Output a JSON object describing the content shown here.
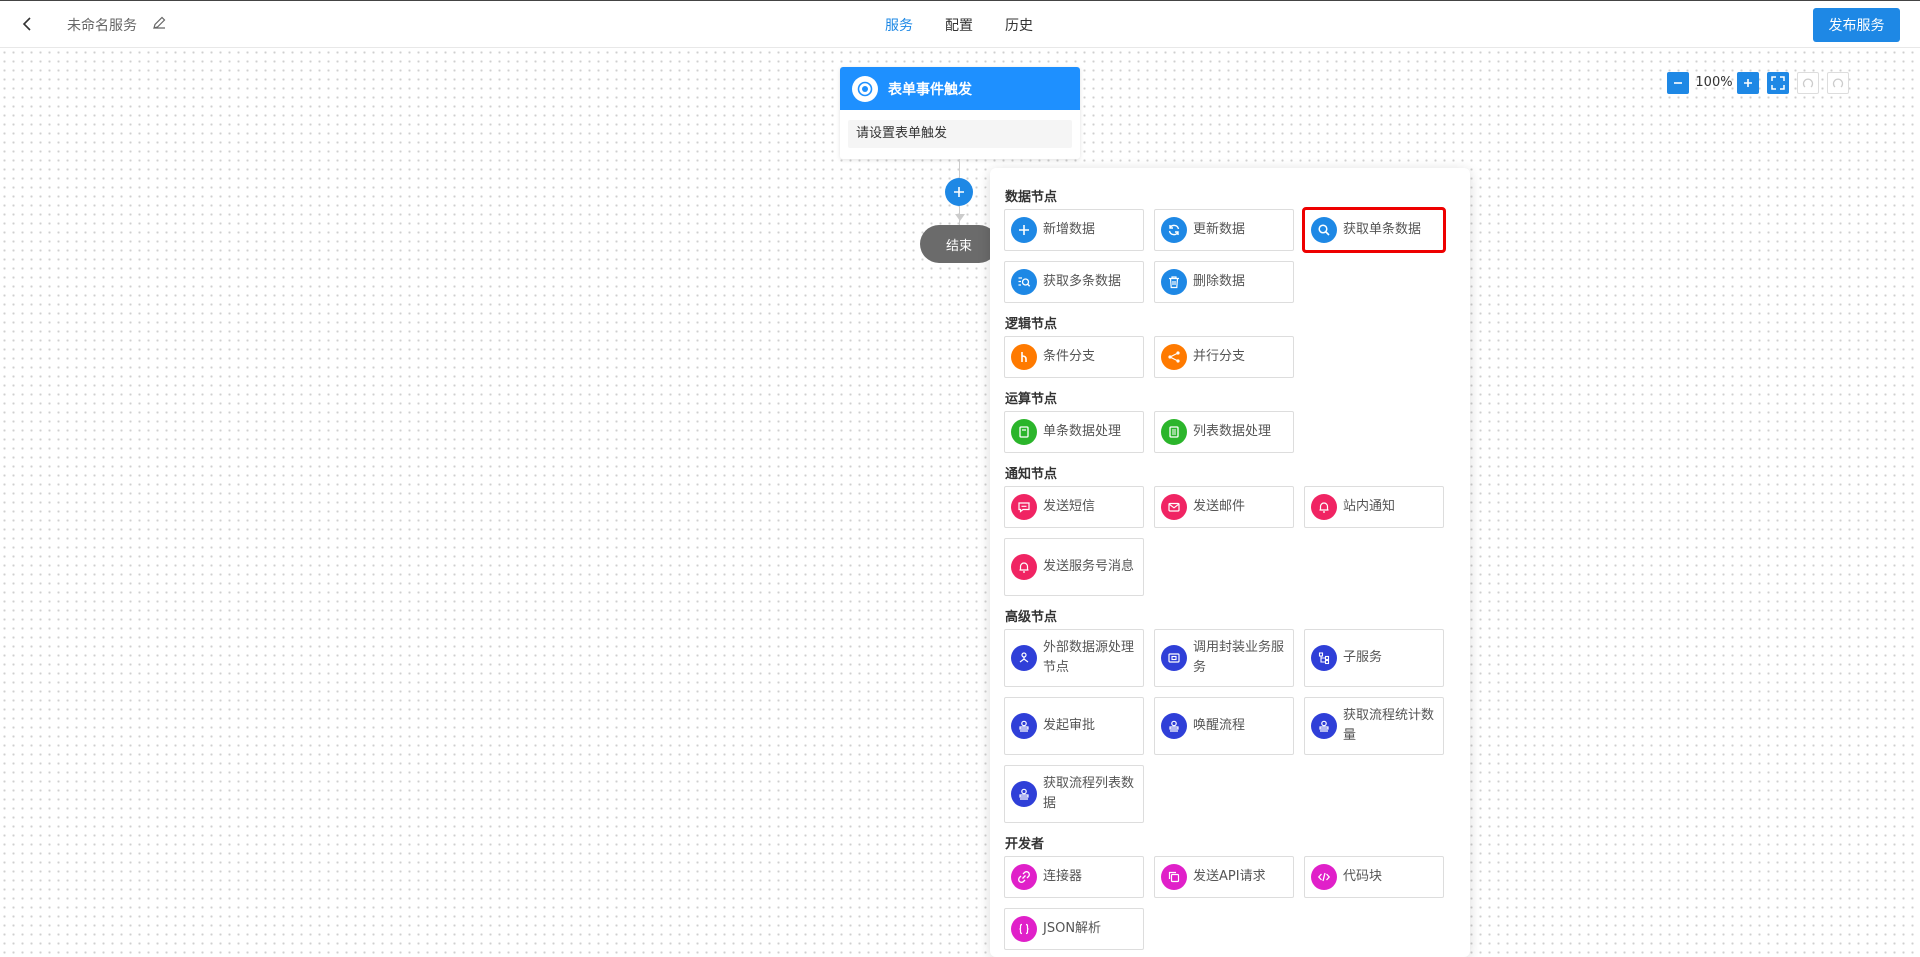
{
  "header": {
    "service_name": "未命名服务",
    "tabs": [
      {
        "label": "服务",
        "active": true
      },
      {
        "label": "配置",
        "active": false
      },
      {
        "label": "历史",
        "active": false
      }
    ],
    "publish_label": "发布服务",
    "accent_color": "#1e88e5"
  },
  "canvas": {
    "zoom_level": "100%",
    "trigger": {
      "title": "表单事件触发",
      "placeholder": "请设置表单触发"
    },
    "end_label": "结束"
  },
  "palette": {
    "sections": [
      {
        "title": "数据节点",
        "items": [
          {
            "label": "新增数据",
            "icon": "plus-icon",
            "color": "#1e88e5"
          },
          {
            "label": "更新数据",
            "icon": "refresh-icon",
            "color": "#1e88e5"
          },
          {
            "label": "获取单条数据",
            "icon": "search-icon",
            "color": "#1e88e5",
            "highlighted": true
          },
          {
            "label": "获取多条数据",
            "icon": "list-search-icon",
            "color": "#1e88e5"
          },
          {
            "label": "删除数据",
            "icon": "trash-icon",
            "color": "#1e88e5"
          }
        ]
      },
      {
        "title": "逻辑节点",
        "items": [
          {
            "label": "条件分支",
            "icon": "branch-icon",
            "color": "#ff7a00"
          },
          {
            "label": "并行分支",
            "icon": "share-icon",
            "color": "#ff7a00"
          }
        ]
      },
      {
        "title": "运算节点",
        "items": [
          {
            "label": "单条数据处理",
            "icon": "document-icon",
            "color": "#2bb52b"
          },
          {
            "label": "列表数据处理",
            "icon": "list-doc-icon",
            "color": "#2bb52b"
          }
        ]
      },
      {
        "title": "通知节点",
        "items": [
          {
            "label": "发送短信",
            "icon": "message-icon",
            "color": "#f02463"
          },
          {
            "label": "发送邮件",
            "icon": "mail-icon",
            "color": "#f02463"
          },
          {
            "label": "站内通知",
            "icon": "bell-icon",
            "color": "#f02463"
          },
          {
            "label": "发送服务号消息",
            "icon": "bell-icon",
            "color": "#f02463"
          }
        ]
      },
      {
        "title": "高级节点",
        "items": [
          {
            "label": "外部数据源处理节点",
            "icon": "hierarchy-icon",
            "color": "#2f3fd8"
          },
          {
            "label": "调用封装业务服务",
            "icon": "box-icon",
            "color": "#2f3fd8"
          },
          {
            "label": "子服务",
            "icon": "tree-icon",
            "color": "#2f3fd8"
          },
          {
            "label": "发起审批",
            "icon": "stamp-icon",
            "color": "#2f3fd8"
          },
          {
            "label": "唤醒流程",
            "icon": "stamp-icon",
            "color": "#2f3fd8"
          },
          {
            "label": "获取流程统计数量",
            "icon": "stamp-icon",
            "color": "#2f3fd8"
          },
          {
            "label": "获取流程列表数据",
            "icon": "stamp-icon",
            "color": "#2f3fd8"
          }
        ]
      },
      {
        "title": "开发者",
        "items": [
          {
            "label": "连接器",
            "icon": "link-icon",
            "color": "#e020c9"
          },
          {
            "label": "发送API请求",
            "icon": "copy-icon",
            "color": "#e020c9"
          },
          {
            "label": "代码块",
            "icon": "code-icon",
            "color": "#e020c9"
          },
          {
            "label": "JSON解析",
            "icon": "json-icon",
            "color": "#e020c9"
          }
        ]
      }
    ]
  }
}
